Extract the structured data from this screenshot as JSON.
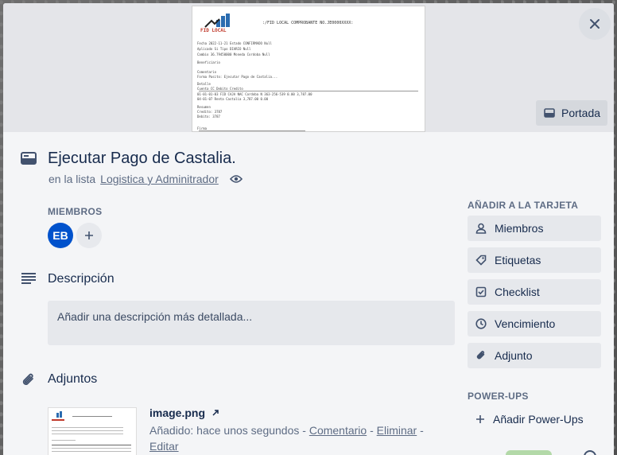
{
  "cover": {
    "button_label": "Portada",
    "document": {
      "logo_text": "FID LOCAL",
      "header": ":/FID LOCAL COMPROBANTE NO.JE0000XXXX:",
      "rows": [
        "Fecha      2022-11-21          Estado   CONFIRMADO     Null",
        "Aplicado   Si                  Tipo     DIARIO         Null",
        "Cambio     36.79450000         Moneda   Cordoba        Null",
        "Beneficiario",
        "Comentario",
        "Forma Pasito: Ejecutar Pago de Castalia...",
        "Detalle",
        "Cuenta                          CC            Debito         Credito",
        "01-01-01-03 FID CAJA NAC Cordoba N 363-256-539      0.00       3,787.00",
        "04-01-07 Renta Castalia                        3,787.00          0.00",
        "Resumen",
        "Credito:  3787",
        "Debito:   3787",
        "Firma"
      ]
    }
  },
  "card": {
    "title": "Ejecutar Pago de Castalia.",
    "in_list_prefix": "en la lista",
    "list_name": "Logistica y Adminitrador"
  },
  "members": {
    "label": "MIEMBROS",
    "avatar_initials": "EB"
  },
  "description": {
    "title": "Descripción",
    "placeholder": "Añadir una descripción más detallada..."
  },
  "attachments": {
    "title": "Adjuntos",
    "file_name": "image.png",
    "added_text": "Añadido: hace unos segundos -",
    "comment_link": "Comentario",
    "delete_link": "Eliminar",
    "edit_link": "Editar",
    "separator": "-"
  },
  "sidebar": {
    "add_label": "AÑADIR A LA TARJETA",
    "buttons": [
      {
        "label": "Miembros",
        "icon": "person-icon"
      },
      {
        "label": "Etiquetas",
        "icon": "tag-icon"
      },
      {
        "label": "Checklist",
        "icon": "checkbox-icon"
      },
      {
        "label": "Vencimiento",
        "icon": "clock-icon"
      },
      {
        "label": "Adjunto",
        "icon": "paperclip-icon"
      }
    ],
    "powerups_label": "POWER-UPS",
    "powerups_button": "Añadir Power-Ups"
  },
  "colors": {
    "avatar": "#0052cc",
    "modal_bg": "#f4f5f7",
    "button_bg": "#e6e8ec"
  }
}
